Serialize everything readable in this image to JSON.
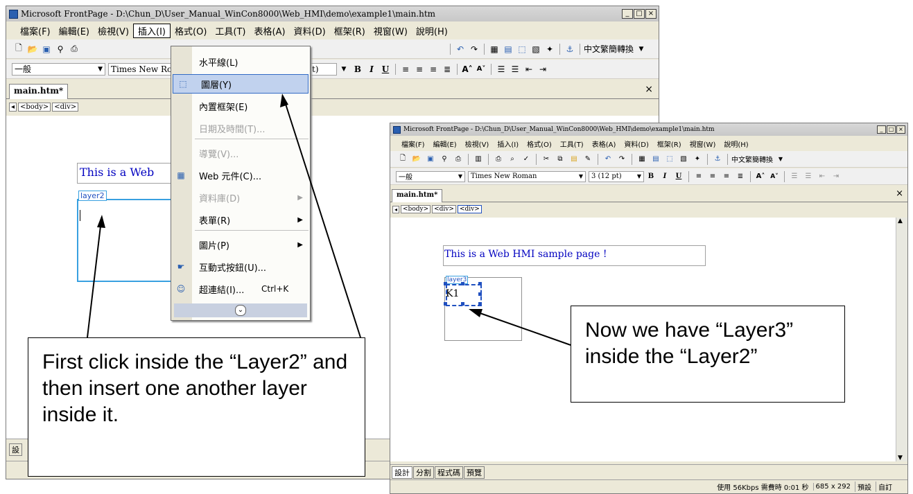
{
  "window1": {
    "title": "Microsoft FrontPage - D:\\Chun_D\\User_Manual_WinCon8000\\Web_HMI\\demo\\example1\\main.htm",
    "menu": [
      "檔案(F)",
      "編輯(E)",
      "檢視(V)",
      "插入(I)",
      "格式(O)",
      "工具(T)",
      "表格(A)",
      "資料(D)",
      "框架(R)",
      "視窗(W)",
      "說明(H)"
    ],
    "toolbar_right_label": "中文繁簡轉換",
    "style_combo": "一般",
    "font_combo": "Times New Ro",
    "size_combo_tail": "t)",
    "doc_tab": "main.htm*",
    "tags": [
      "<body>",
      "<div>"
    ],
    "heading_text": "This is a Web",
    "layer_label": "layer2",
    "view_tab": "設"
  },
  "insert_menu": {
    "items": [
      {
        "label": "水平線(L)",
        "disabled": false,
        "icon": ""
      },
      {
        "label": "圖層(Y)",
        "disabled": false,
        "icon": "layer-icon",
        "highlighted": true
      },
      {
        "label": "內置框架(E)",
        "disabled": false,
        "icon": ""
      },
      {
        "label": "日期及時間(T)...",
        "disabled": true,
        "icon": ""
      },
      {
        "label": "導覽(V)...",
        "disabled": true,
        "icon": ""
      },
      {
        "label": "Web 元件(C)...",
        "disabled": false,
        "icon": "web-component-icon"
      },
      {
        "label": "資料庫(D)",
        "disabled": true,
        "icon": "",
        "submenu": true
      },
      {
        "label": "表單(R)",
        "disabled": false,
        "icon": "",
        "submenu": true
      },
      {
        "label": "圖片(P)",
        "disabled": false,
        "icon": "",
        "submenu": true
      },
      {
        "label": "互動式按鈕(U)...",
        "disabled": false,
        "icon": "interactive-button-icon"
      },
      {
        "label": "超連結(I)...",
        "disabled": false,
        "icon": "hyperlink-icon",
        "shortcut": "Ctrl+K"
      }
    ],
    "expand_glyph": "»"
  },
  "window2": {
    "title": "Microsoft FrontPage - D:\\Chun_D\\User_Manual_WinCon8000\\Web_HMI\\demo\\example1\\main.htm",
    "menu": [
      "檔案(F)",
      "編輯(E)",
      "檢視(V)",
      "插入(I)",
      "格式(O)",
      "工具(T)",
      "表格(A)",
      "資料(D)",
      "框架(R)",
      "視窗(W)",
      "說明(H)"
    ],
    "toolbar_right_label": "中文繁簡轉換",
    "style_combo": "一般",
    "font_combo": "Times New Roman",
    "size_combo": "3  (12 pt)",
    "doc_tab": "main.htm*",
    "tags": [
      "<body>",
      "<div>",
      "<div>"
    ],
    "heading_text": "This is a Web HMI sample page !",
    "layer_label": "layer3",
    "layer_content": "K1",
    "view_tabs": [
      "設計",
      "分割",
      "程式碼",
      "預覽"
    ],
    "status_text": "使用 56Kbps 需費時 0:01 秒",
    "status_size": "685 x 292",
    "status_mode1": "預設",
    "status_mode2": "自訂"
  },
  "callouts": {
    "left": "First click inside the “Layer2” and then insert one another layer inside it.",
    "right": "Now we have “Layer3” inside the “Layer2”"
  }
}
